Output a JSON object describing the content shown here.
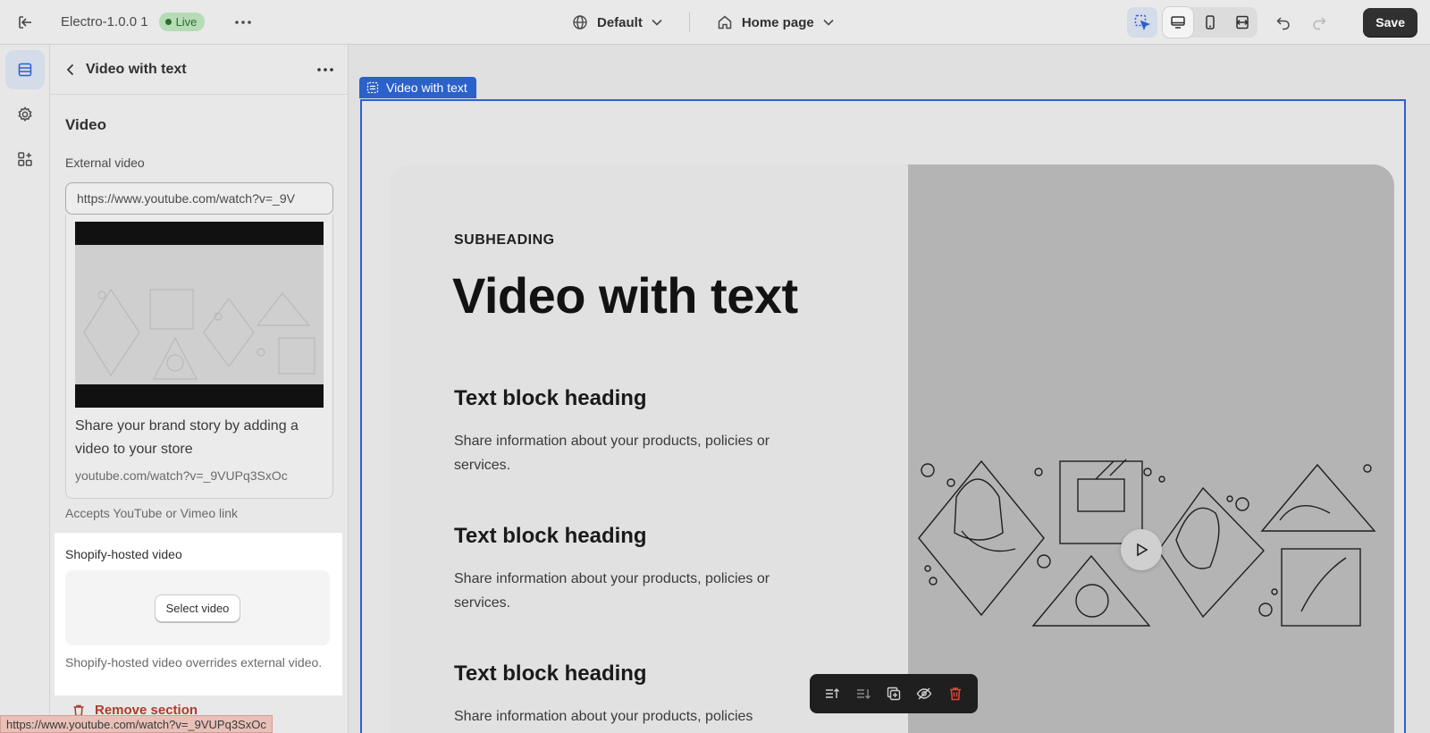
{
  "topbar": {
    "store_name": "Electro-1.0.0 1",
    "live_label": "Live",
    "theme_selector": "Default",
    "page_selector": "Home page",
    "save_label": "Save"
  },
  "panel": {
    "title": "Video with text",
    "section_title": "Video",
    "external_label": "External video",
    "external_value": "https://www.youtube.com/watch?v=_9V",
    "preview_desc": "Share your brand story by adding a video to your store",
    "preview_url": "youtube.com/watch?v=_9VUPq3SxOc",
    "accepts_hint": "Accepts YouTube or Vimeo link",
    "hosted_label": "Shopify-hosted video",
    "select_button": "Select video",
    "hosted_help": "Shopify-hosted video overrides external video.",
    "remove_label": "Remove section"
  },
  "status_url": "https://www.youtube.com/watch?v=_9VUPq3SxOc",
  "canvas": {
    "section_tag": "Video with text",
    "subheading": "SUBHEADING",
    "heading": "Video with text",
    "blocks": [
      {
        "heading": "Text block heading",
        "text": "Share information about your products, policies or services."
      },
      {
        "heading": "Text block heading",
        "text": "Share information about your products, policies or services."
      },
      {
        "heading": "Text block heading",
        "text": "Share information about your products, policies"
      }
    ]
  },
  "colors": {
    "accent": "#2b61c9",
    "live_bg": "#b6dcb5",
    "danger": "#b23a2b",
    "save_bg": "#303030"
  }
}
